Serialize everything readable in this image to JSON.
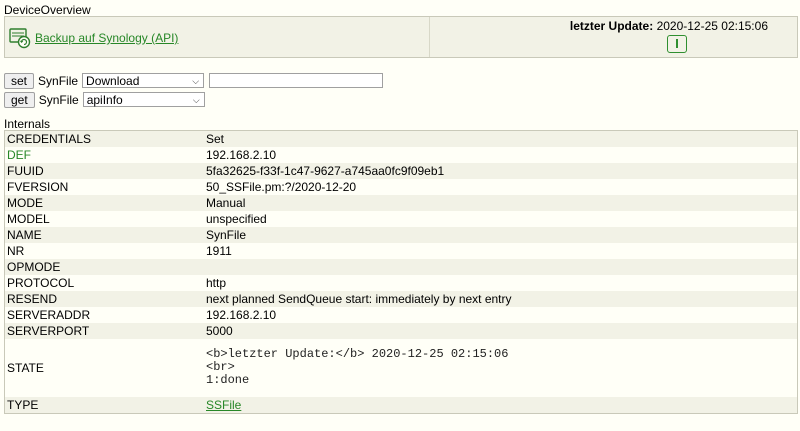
{
  "overview": {
    "title": "DeviceOverview",
    "backup_link": "Backup auf Synology (API)",
    "update_label": "letzter Update:",
    "update_value": "2020-12-25 02:15:06"
  },
  "commands": {
    "set": {
      "button": "set",
      "device": "SynFile",
      "selected": "Download",
      "input_value": ""
    },
    "get": {
      "button": "get",
      "device": "SynFile",
      "selected": "apiInfo"
    }
  },
  "internals": {
    "title": "Internals",
    "rows": [
      {
        "key": "CREDENTIALS",
        "value": "Set"
      },
      {
        "key": "DEF",
        "value": "192.168.2.10"
      },
      {
        "key": "FUUID",
        "value": "5fa32625-f33f-1c47-9627-a745aa0fc9f09eb1"
      },
      {
        "key": "FVERSION",
        "value": "50_SSFile.pm:?/2020-12-20"
      },
      {
        "key": "MODE",
        "value": "Manual"
      },
      {
        "key": "MODEL",
        "value": "unspecified"
      },
      {
        "key": "NAME",
        "value": "SynFile"
      },
      {
        "key": "NR",
        "value": "1911"
      },
      {
        "key": "OPMODE",
        "value": ""
      },
      {
        "key": "PROTOCOL",
        "value": "http"
      },
      {
        "key": "RESEND",
        "value": "next planned SendQueue start: immediately by next entry"
      },
      {
        "key": "SERVERADDR",
        "value": "192.168.2.10"
      },
      {
        "key": "SERVERPORT",
        "value": "5000"
      },
      {
        "key": "STATE",
        "value_lines": [
          "<b>letzter Update:</b> 2020-12-25 02:15:06",
          "<br>",
          "1:done"
        ]
      },
      {
        "key": "TYPE",
        "value": "SSFile"
      }
    ]
  },
  "colors": {
    "background": "#fffff7",
    "row_alt": "#f2f2e6",
    "link_green": "#278727"
  }
}
